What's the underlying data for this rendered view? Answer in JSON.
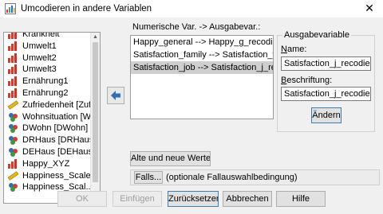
{
  "window": {
    "title": "Umcodieren in andere Variablen",
    "close_glyph": "✕"
  },
  "variables": [
    {
      "label": "Krankheit",
      "icon": "scale-icon"
    },
    {
      "label": "Umwelt1",
      "icon": "scale-icon"
    },
    {
      "label": "Umwelt2",
      "icon": "scale-icon"
    },
    {
      "label": "Umwelt3",
      "icon": "scale-icon"
    },
    {
      "label": "Ernährung1",
      "icon": "scale-icon"
    },
    {
      "label": "Ernährung2",
      "icon": "scale-icon"
    },
    {
      "label": "Zufriedenheit [Zuf...",
      "icon": "ruler-icon"
    },
    {
      "label": "Wohnsituation [W...",
      "icon": "nominal-icon"
    },
    {
      "label": "DWohn [DWohn]",
      "icon": "nominal-icon"
    },
    {
      "label": "DRHaus [DRHaus]",
      "icon": "nominal-icon"
    },
    {
      "label": "DEHaus [DEHaus]",
      "icon": "nominal-icon"
    },
    {
      "label": "Happy_XYZ",
      "icon": "scale-icon"
    },
    {
      "label": "Happiness_Scale",
      "icon": "ruler-icon"
    },
    {
      "label": "Happiness_Scal...",
      "icon": "nominal-icon"
    }
  ],
  "mapping": {
    "header": "Numerische Var. -> Ausgabevar.:",
    "items": [
      {
        "text": "Happy_general --> Happy_g_recodiert",
        "selected": false
      },
      {
        "text": "Satisfaction_family --> Satisfaction_f_r...",
        "selected": false
      },
      {
        "text": "Satisfaction_job --> Satisfaction_j_reco...",
        "selected": true
      }
    ]
  },
  "output": {
    "legend": "Ausgabevariable",
    "name_label": "Name:",
    "name_value": "Satisfaction_j_recodiert",
    "label_label": "Beschriftung:",
    "label_value": "Satisfaction_j_recodiert",
    "change_button": "Ändern"
  },
  "buttons": {
    "old_new": "Alte und neue Werte...",
    "if": "Falls...",
    "if_note": "(optionale Fallauswahlbedingung)",
    "ok": "OK",
    "paste": "Einfügen",
    "reset": "Zurücksetzen",
    "cancel": "Abbrechen",
    "help": "Hilfe"
  },
  "colors": {
    "accent": "#3c7fb1",
    "arrow_blue": "#2f6fb3",
    "selection": "#cfcfcf"
  }
}
